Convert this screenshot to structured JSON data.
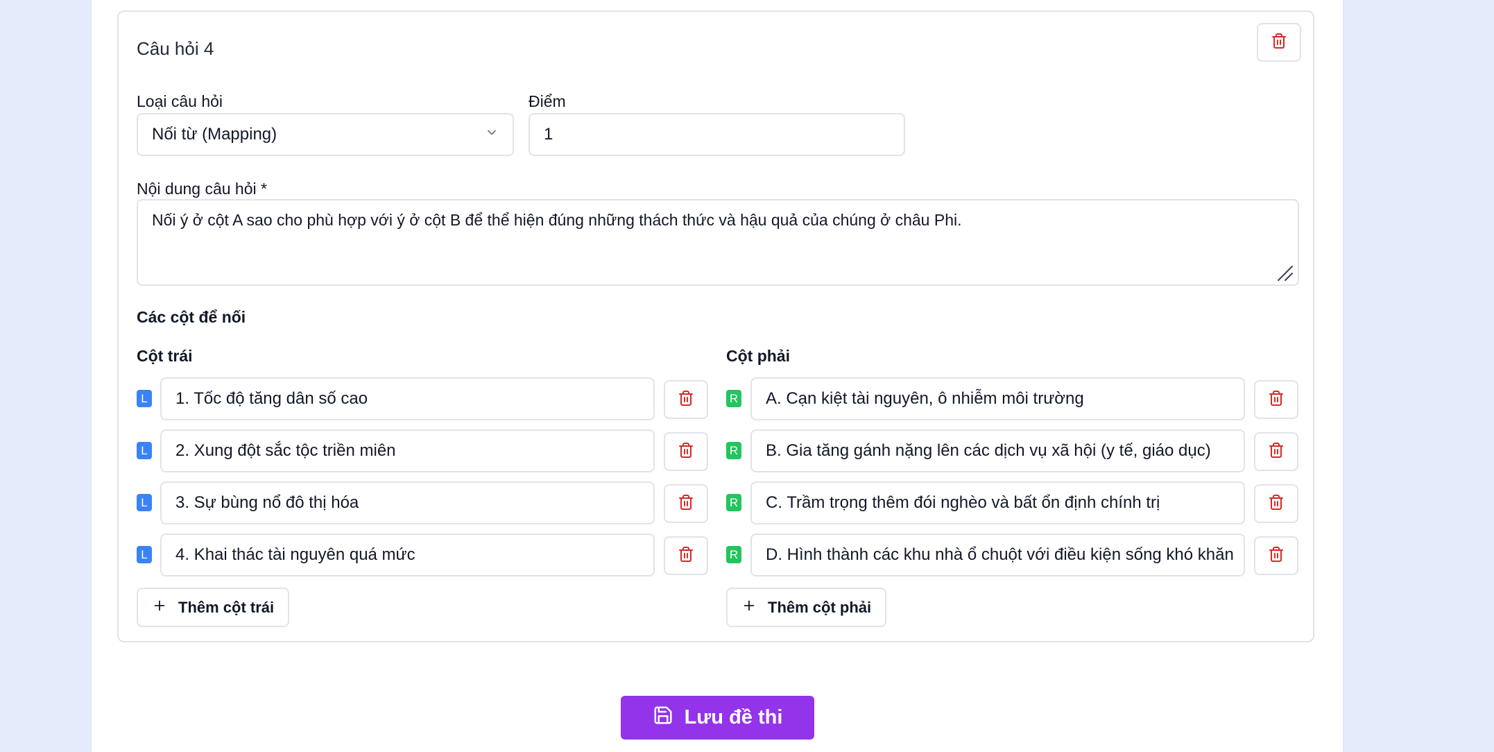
{
  "question": {
    "title": "Câu hỏi 4",
    "type_label": "Loại câu hỏi",
    "type_value": "Nối từ (Mapping)",
    "points_label": "Điểm",
    "points_value": "1",
    "content_label": "Nội dung câu hỏi *",
    "content_value": "Nối ý ở cột A sao cho phù hợp với ý ở cột B để thể hiện đúng những thách thức và hậu quả của chúng ở châu Phi."
  },
  "mapping": {
    "section_label": "Các cột để nối",
    "left": {
      "label": "Cột trái",
      "badge": "L",
      "items": [
        "1. Tốc độ tăng dân số cao",
        "2. Xung đột sắc tộc triền miên",
        "3. Sự bùng nổ đô thị hóa",
        "4. Khai thác tài nguyên quá mức"
      ],
      "add_label": "Thêm cột trái"
    },
    "right": {
      "label": "Cột phải",
      "badge": "R",
      "items": [
        "A. Cạn kiệt tài nguyên, ô nhiễm môi trường",
        "B. Gia tăng gánh nặng lên các dịch vụ xã hội (y tế, giáo dục)",
        "C. Trầm trọng thêm đói nghèo và bất ổn định chính trị",
        "D. Hình thành các khu nhà ổ chuột với điều kiện sống khó khăn"
      ],
      "add_label": "Thêm cột phải"
    }
  },
  "actions": {
    "save_label": "Lưu đề thi"
  },
  "icons": {
    "delete": "trash-icon",
    "dropdown": "chevron-down-icon",
    "add": "plus-icon",
    "save": "save-icon"
  },
  "colors": {
    "background": "#e6ebfb",
    "danger": "#dc2626",
    "left_badge": "#3b82f6",
    "right_badge": "#22c55e",
    "primary": "#9333ea"
  }
}
